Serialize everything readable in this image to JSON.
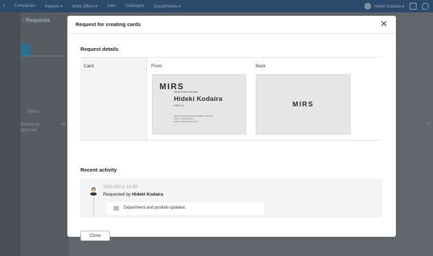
{
  "background": {
    "nav_items": [
      "s",
      "Companies",
      "Reports ▾",
      "Work Offers ▾",
      "Jobs",
      "Catalogue",
      "Departments ▾"
    ],
    "user_menu": "Hideki Kodaira ▾",
    "page_title": ": Requests",
    "status_header": "Status",
    "status_value": "Waiting for approval",
    "column_fragment": "ka",
    "number_fragment": "20"
  },
  "modal": {
    "title": "Request for creating cards",
    "close_icon": "close-icon",
    "details": {
      "section_title": "Request details",
      "row_label": "Card",
      "front_label": "Front",
      "back_label": "Back",
      "card_front": {
        "logo": "MIRS",
        "role": "Media Division Manager",
        "name": "Hideki Kodaira",
        "company": "MIRS Ltd.",
        "address": "1961 Hayfield Sunset Road Back, 00-0711",
        "phone": "Phone: 011-000-0110",
        "email": "Email: info@example.com"
      },
      "card_back": {
        "logo": "MIRS"
      }
    },
    "activity": {
      "section_title": "Recent activity",
      "time": "2021/05/11 15:30",
      "action_prefix": "Requested by",
      "actor": "Hideki Kodaira",
      "comment_icon": "comment-icon",
      "comment": "Department and position updated."
    },
    "close_button": "Close"
  }
}
